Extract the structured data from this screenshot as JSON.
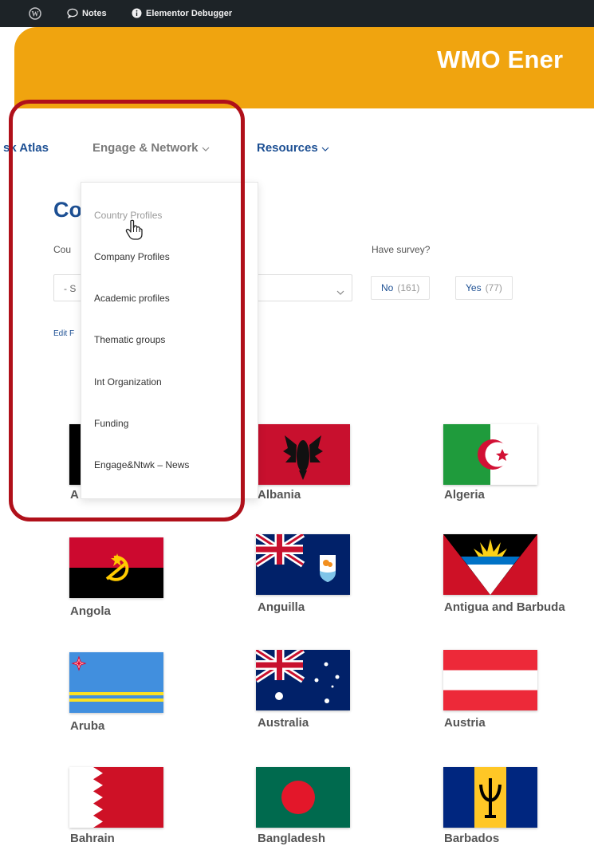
{
  "admin_bar": {
    "notes_label": "Notes",
    "debugger_label": "Elementor Debugger"
  },
  "header": {
    "site_title": "WMO Ener"
  },
  "nav": {
    "items": [
      {
        "label": "sk Atlas"
      },
      {
        "label": "Engage & Network"
      },
      {
        "label": "Resources"
      }
    ]
  },
  "dropdown": {
    "items": [
      {
        "label": "Country Profiles"
      },
      {
        "label": "Company Profiles"
      },
      {
        "label": "Academic profiles"
      },
      {
        "label": "Thematic groups"
      },
      {
        "label": "Int Organization"
      },
      {
        "label": "Funding"
      },
      {
        "label": "Engage&Ntwk – News"
      }
    ]
  },
  "main": {
    "page_title": "Co",
    "country_label": "Cou",
    "survey_label": "Have survey?",
    "select_value": "- S",
    "filters": [
      {
        "label": "No",
        "count": "(161)"
      },
      {
        "label": "Yes",
        "count": "(77)"
      }
    ],
    "edit_link": "Edit F"
  },
  "countries": [
    {
      "name": "A",
      "flag": "afghanistan"
    },
    {
      "name": "Albania",
      "flag": "albania"
    },
    {
      "name": "Algeria",
      "flag": "algeria"
    },
    {
      "name": "Angola",
      "flag": "angola"
    },
    {
      "name": "Anguilla",
      "flag": "anguilla"
    },
    {
      "name": "Antigua and Barbuda",
      "flag": "antigua-and-barbuda"
    },
    {
      "name": "Aruba",
      "flag": "aruba"
    },
    {
      "name": "Australia",
      "flag": "australia"
    },
    {
      "name": "Austria",
      "flag": "austria"
    },
    {
      "name": "Bahrain",
      "flag": "bahrain"
    },
    {
      "name": "Bangladesh",
      "flag": "bangladesh"
    },
    {
      "name": "Barbados",
      "flag": "barbados"
    }
  ],
  "colors": {
    "header_orange": "#f0a40f",
    "brand_blue": "#1c4f93",
    "highlight_red": "#b0101a",
    "admin_bar": "#1d2327"
  }
}
